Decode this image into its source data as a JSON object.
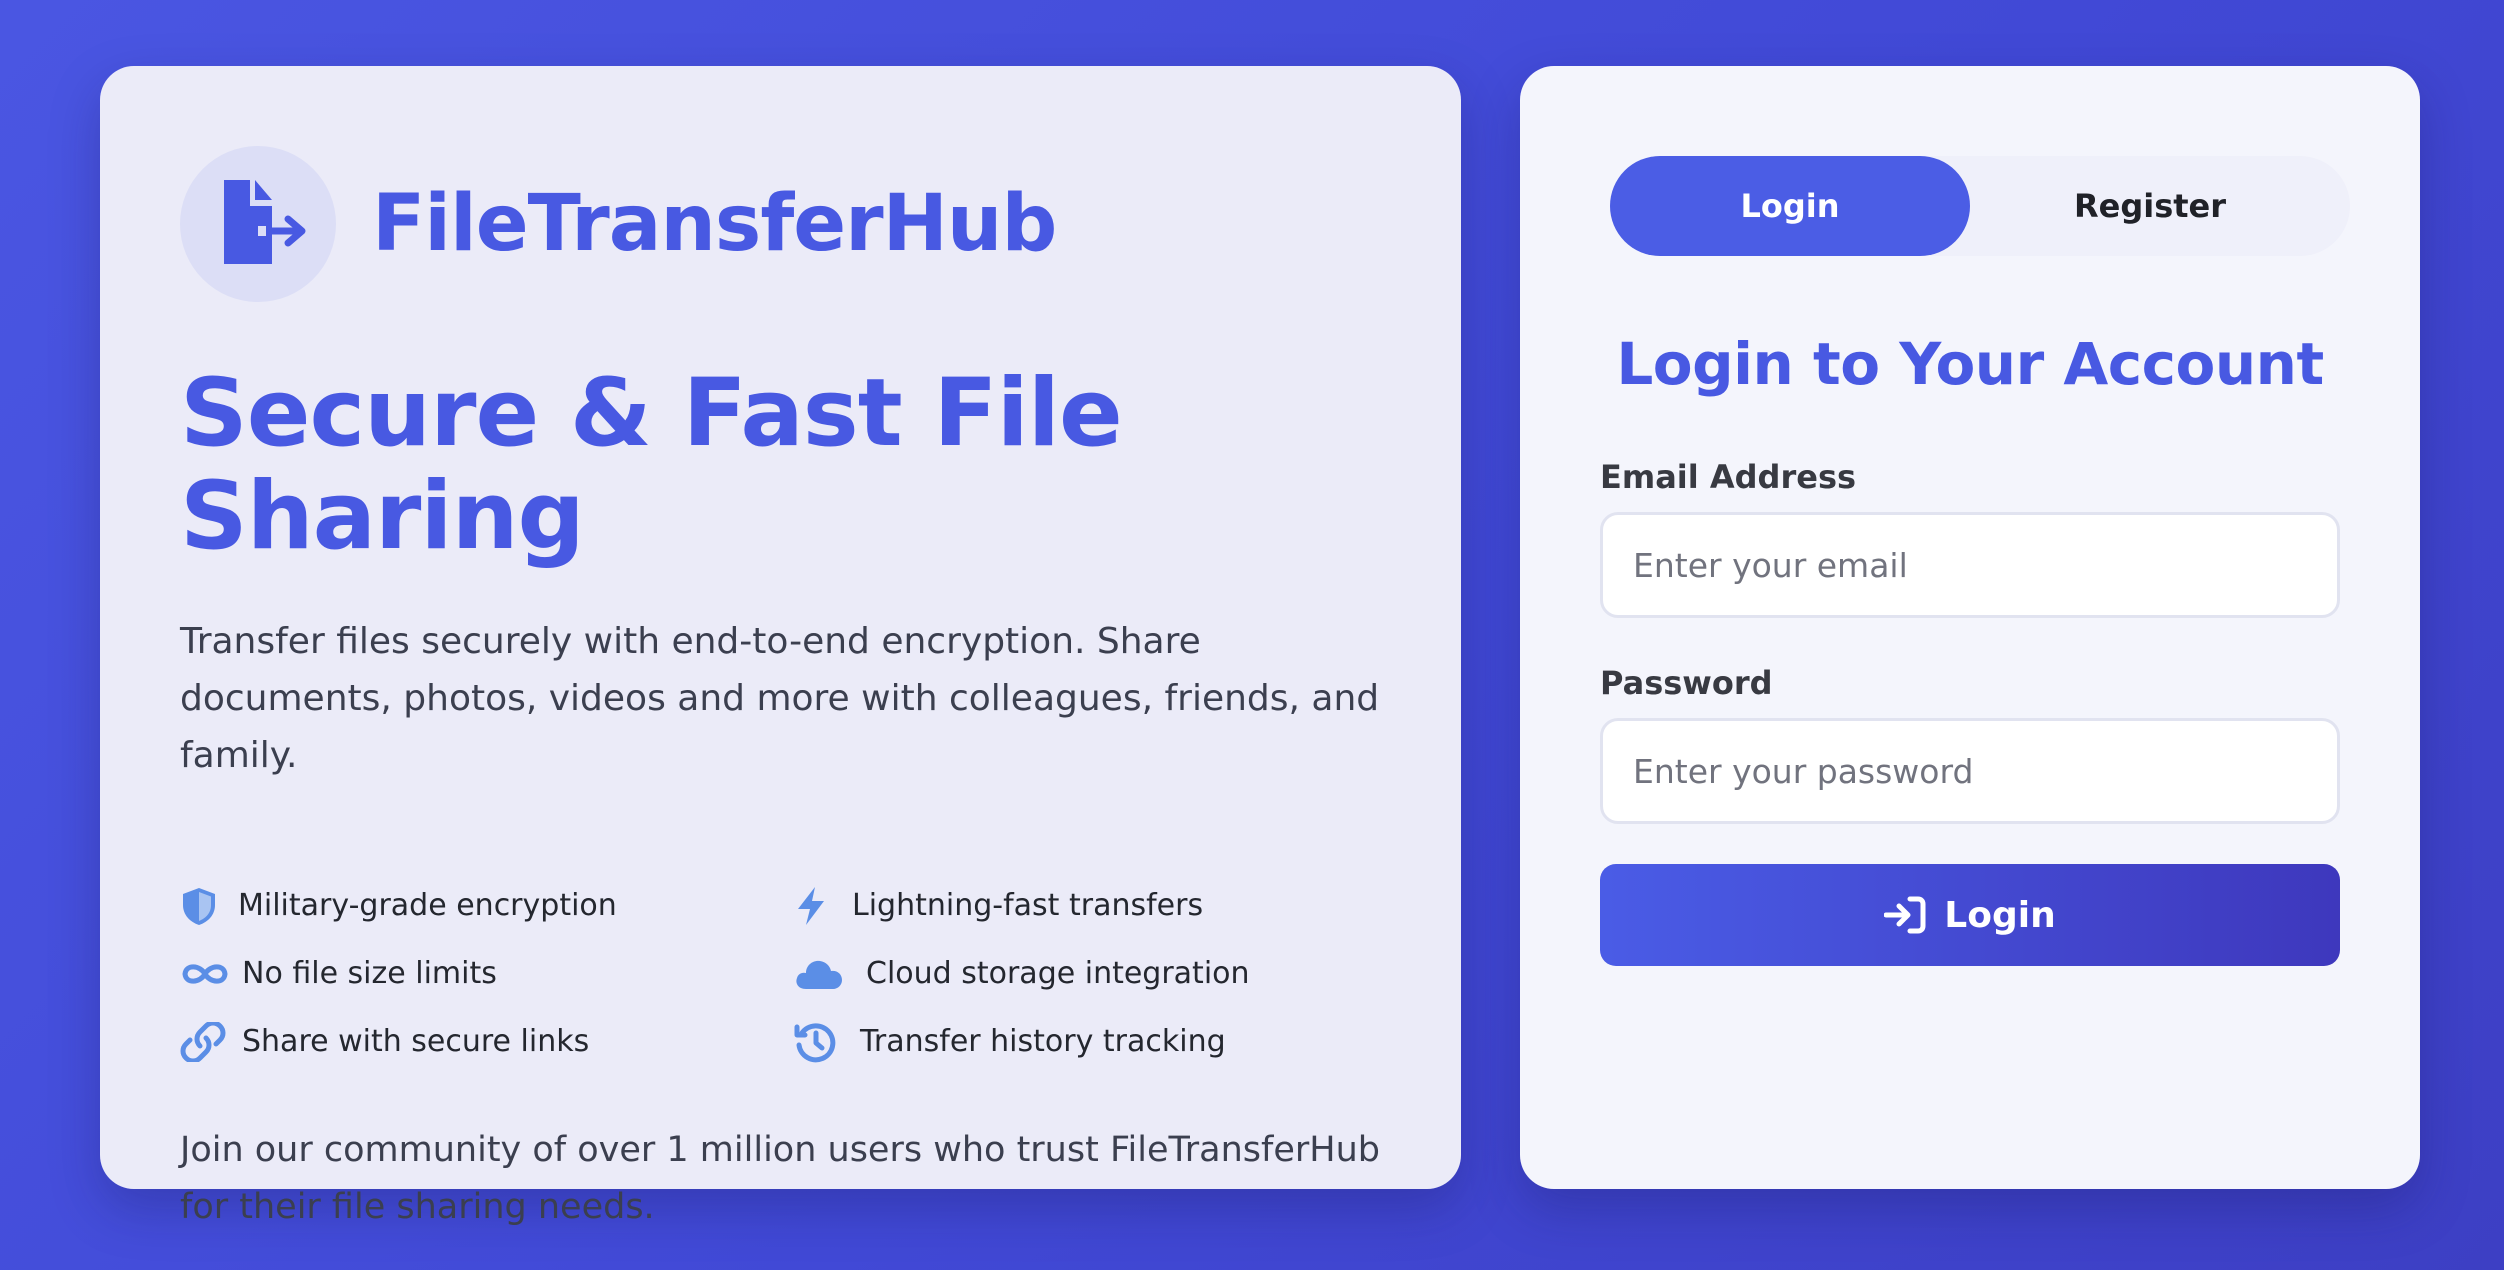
{
  "brand": {
    "name": "FileTransferHub",
    "logo_icon": "file-export-icon",
    "accent_color": "#4859e2"
  },
  "hero": {
    "title": "Secure & Fast File Sharing",
    "description": "Transfer files securely with end-to-end encryption. Share documents, photos, videos and more with colleagues, friends, and family."
  },
  "features": [
    {
      "icon": "shield-icon",
      "label": "Military-grade encryption"
    },
    {
      "icon": "lightning-icon",
      "label": "Lightning-fast transfers"
    },
    {
      "icon": "infinity-icon",
      "label": "No file size limits"
    },
    {
      "icon": "cloud-icon",
      "label": "Cloud storage integration"
    },
    {
      "icon": "link-icon",
      "label": "Share with secure links"
    },
    {
      "icon": "history-icon",
      "label": "Transfer history tracking"
    }
  ],
  "join_text": "Join our community of over 1 million users who trust FileTransferHub for their file sharing needs.",
  "auth": {
    "tabs": [
      {
        "label": "Login",
        "active": true
      },
      {
        "label": "Register",
        "active": false
      }
    ],
    "form_title": "Login to Your Account",
    "email": {
      "label": "Email Address",
      "placeholder": "Enter your email",
      "value": ""
    },
    "password": {
      "label": "Password",
      "placeholder": "Enter your password",
      "value": ""
    },
    "submit": {
      "label": "Login",
      "icon": "sign-in-icon"
    }
  }
}
